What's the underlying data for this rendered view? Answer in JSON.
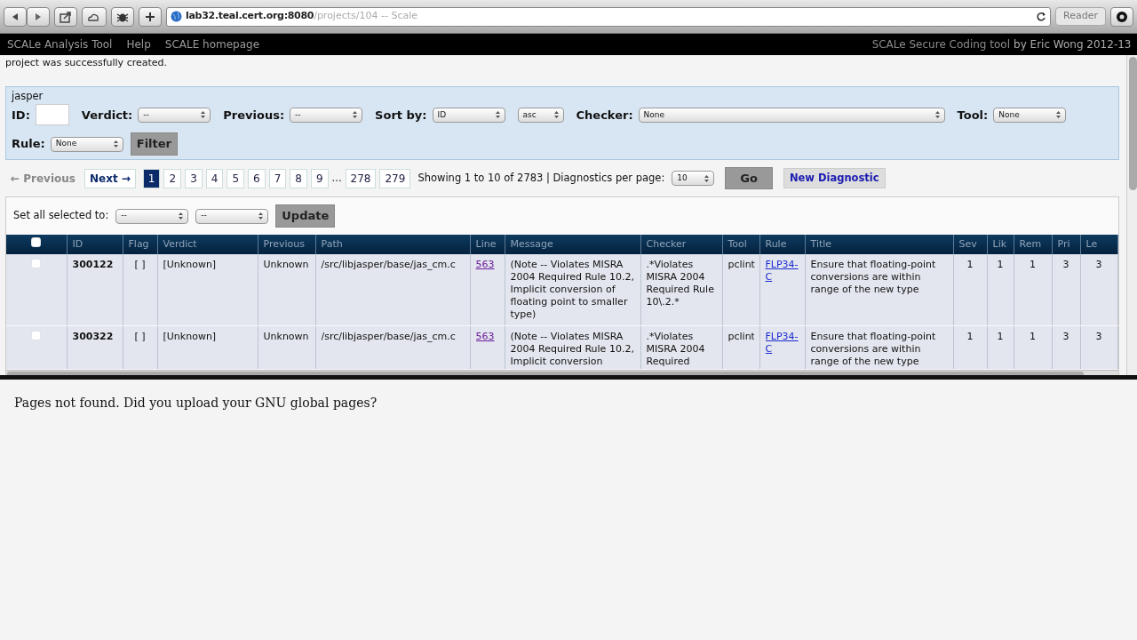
{
  "browser": {
    "url_host": "lab32.teal.cert.org:8080",
    "url_path": "/projects/104 -- Scale",
    "reader": "Reader"
  },
  "navbar": {
    "links": [
      "SCALe Analysis Tool",
      "Help",
      "SCALE homepage"
    ],
    "credit_tool": "SCALe Secure Coding tool",
    "credit_author": "by Eric Wong 2012-13"
  },
  "flash": "project was successfully created.",
  "filter": {
    "project": "jasper",
    "fields": [
      {
        "kind": "text",
        "label": "ID:"
      },
      {
        "kind": "select",
        "label": "Verdict:",
        "value": "--"
      },
      {
        "kind": "select",
        "label": "Previous:",
        "value": "--"
      },
      {
        "kind": "select",
        "label": "Sort by:",
        "value": "ID"
      },
      {
        "kind": "select",
        "value": "asc"
      },
      {
        "kind": "select",
        "label": "Checker:",
        "value": "None",
        "wide": true
      },
      {
        "kind": "select",
        "label": "Tool:",
        "value": "None"
      },
      {
        "kind": "select",
        "label": "Rule:",
        "value": "None"
      }
    ],
    "button": "Filter"
  },
  "pagination": {
    "previous": {
      "label": "← Previous",
      "disabled": true
    },
    "next": {
      "label": "Next →",
      "disabled": false
    },
    "pages": [
      {
        "label": "1",
        "selected": true
      },
      {
        "label": "2",
        "selected": false
      },
      {
        "label": "3",
        "selected": false
      },
      {
        "label": "4",
        "selected": false
      },
      {
        "label": "5",
        "selected": false
      },
      {
        "label": "6",
        "selected": false
      },
      {
        "label": "7",
        "selected": false
      },
      {
        "label": "8",
        "selected": false
      },
      {
        "label": "9",
        "selected": false
      },
      {
        "label": "...",
        "kind": "gap"
      },
      {
        "label": "278",
        "selected": false
      },
      {
        "label": "279",
        "selected": false
      }
    ],
    "summary": "Showing 1 to 10 of 2783 | Diagnostics per page:",
    "per_page": "10",
    "go": "Go",
    "new_diagnostic": "New Diagnostic"
  },
  "bulk": {
    "label": "Set all selected to:",
    "selects": [
      "--",
      "--"
    ],
    "button": "Update"
  },
  "table": {
    "select_all_checked": false,
    "columns": [
      "ID",
      "Flag",
      "Verdict",
      "Previous",
      "Path",
      "Line",
      "Message",
      "Checker",
      "Tool",
      "Rule",
      "Title",
      "Sev",
      "Lik",
      "Rem",
      "Pri",
      "Le"
    ],
    "rows": [
      {
        "checked": false,
        "cells": [
          "300122",
          "[ ]",
          "[Unknown]",
          "Unknown",
          "/src/libjasper/base/jas_cm.c",
          "563",
          "(Note -- Violates MISRA 2004 Required Rule 10.2, Implicit conversion of floating point to smaller type)",
          ".*Violates MISRA 2004 Required Rule 10\\.2.*",
          "pclint",
          "FLP34-C",
          "Ensure that floating-point conversions are within range of the new type",
          "1",
          "1",
          "1",
          "3",
          "3"
        ]
      },
      {
        "checked": false,
        "cells": [
          "300322",
          "[ ]",
          "[Unknown]",
          "Unknown",
          "/src/libjasper/base/jas_cm.c",
          "563",
          "(Note -- Violates MISRA 2004 Required Rule 10.2, Implicit conversion",
          ".*Violates MISRA 2004 Required",
          "pclint",
          "FLP34-C",
          "Ensure that floating-point conversions are within range of the new type",
          "1",
          "1",
          "1",
          "3",
          "3"
        ]
      }
    ]
  },
  "lower_frame": {
    "message": "Pages not found. Did you upload your GNU global pages?"
  }
}
